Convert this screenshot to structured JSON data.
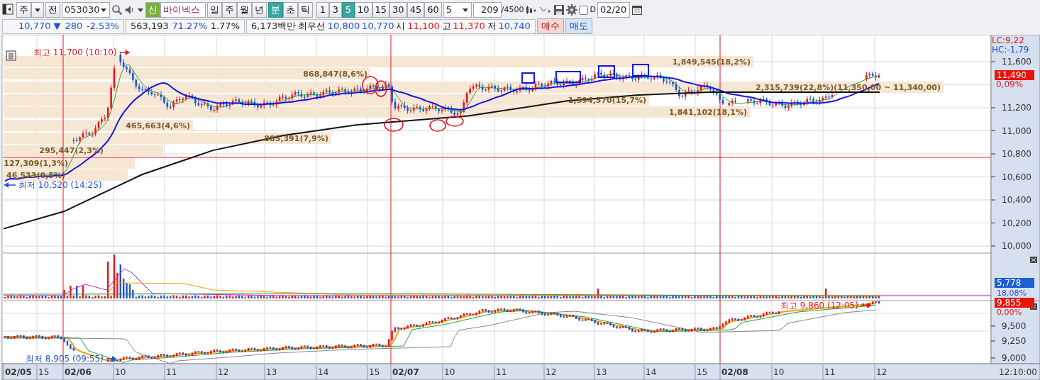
{
  "toolbar": {
    "market": "주",
    "prev_button": "전",
    "code": "053030",
    "badge": "신",
    "name": "바이넥스",
    "periods": [
      {
        "label": "일",
        "selected": false
      },
      {
        "label": "주",
        "selected": false
      },
      {
        "label": "월",
        "selected": false
      },
      {
        "label": "년",
        "selected": false
      }
    ],
    "units": [
      {
        "label": "분",
        "selected": true
      },
      {
        "label": "초",
        "selected": false
      },
      {
        "label": "틱",
        "selected": false
      }
    ],
    "intervals": [
      {
        "label": "1",
        "selected": false
      },
      {
        "label": "3",
        "selected": false
      },
      {
        "label": "5",
        "selected": true
      },
      {
        "label": "10",
        "selected": false
      },
      {
        "label": "15",
        "selected": false
      },
      {
        "label": "30",
        "selected": false
      },
      {
        "label": "45",
        "selected": false
      },
      {
        "label": "60",
        "selected": false
      }
    ],
    "count_select": "5",
    "count": "209",
    "count_total": "/4500",
    "d_checkbox": {
      "label": "D",
      "checked": false
    },
    "date": "02/20"
  },
  "quote": {
    "cells": [
      [
        {
          "text": "10,770 ▼",
          "color": "#1c4fd8"
        },
        {
          "text": "280",
          "color": "#1c4fd8"
        },
        {
          "text": "-2.53%",
          "color": "#1c4fd8"
        }
      ],
      [
        {
          "text": "563,193",
          "color": "#222222"
        },
        {
          "text": "71.27%",
          "color": "#1c4fd8"
        },
        {
          "text": "1.77%",
          "color": "#222222"
        }
      ],
      [
        {
          "text": "6,173백만",
          "color": "#222222"
        },
        {
          "text": "최우선"
        },
        {
          "text": "10,800",
          "color": "#1c4fd8"
        },
        {
          "text": "10,770",
          "color": "#1c4fd8"
        },
        {
          "text": "시"
        },
        {
          "text": "11,100",
          "color": "#e8141c"
        },
        {
          "text": "고"
        },
        {
          "text": "11,370",
          "color": "#e8141c"
        },
        {
          "text": "저"
        },
        {
          "text": "10,740",
          "color": "#1c4fd8"
        }
      ]
    ],
    "buy_button": "매수",
    "sell_button": "매도"
  },
  "price_chart": {
    "annotations": [
      {
        "text": "최고 11,700 (10:10)",
        "kind": "high"
      },
      {
        "text": "최저 10,520 (14:25)",
        "kind": "low"
      }
    ],
    "profile_bands": [
      {
        "label": "1,849,545(18,2%)"
      },
      {
        "label": "868,847(8,6%)"
      },
      {
        "label": "2,315,739(22,8%)(11,350,00 ~ 11,340,00)"
      },
      {
        "label": "1,594,570(15,7%)"
      },
      {
        "label": "1,841,102(18,1%)"
      },
      {
        "label": "465,663(4,6%)"
      },
      {
        "label": "885,391(7,9%)"
      },
      {
        "label": "295,447(2,3%)"
      },
      {
        "label": "127,309(1,3%)"
      },
      {
        "label": "46,533(0,5%)"
      }
    ]
  },
  "price_axis": {
    "lc": "LC:9,22",
    "hc": "HC:-1,79",
    "ticks": [
      "11,600",
      "11,200",
      "11,000",
      "10,800",
      "10,600",
      "10,400",
      "10,200",
      "10,000"
    ],
    "current_price": "11,490",
    "change": "0,09%"
  },
  "volume_axis": {
    "value": "5,778",
    "ratio": "18,08%"
  },
  "lower_chart": {
    "annotations": [
      {
        "text": "최저 8,905 (09:55)",
        "kind": "low"
      },
      {
        "text": "최고 9,860 (12:05)",
        "kind": "high"
      }
    ]
  },
  "lower_axis": {
    "value": "9,855",
    "change": "0,00%",
    "ticks": [
      "9,500",
      "9,250",
      "9,000"
    ]
  },
  "time_axis": {
    "labels": [
      {
        "text": "02/05",
        "kind": "date"
      },
      {
        "text": "15",
        "kind": "hour"
      },
      {
        "text": "02/06",
        "kind": "date"
      },
      {
        "text": "10",
        "kind": "hour"
      },
      {
        "text": "11",
        "kind": "hour"
      },
      {
        "text": "12",
        "kind": "hour"
      },
      {
        "text": "13",
        "kind": "hour"
      },
      {
        "text": "14",
        "kind": "hour"
      },
      {
        "text": "15",
        "kind": "hour"
      },
      {
        "text": "02/07",
        "kind": "date"
      },
      {
        "text": "10",
        "kind": "hour"
      },
      {
        "text": "11",
        "kind": "hour"
      },
      {
        "text": "12",
        "kind": "hour"
      },
      {
        "text": "13",
        "kind": "hour"
      },
      {
        "text": "14",
        "kind": "hour"
      },
      {
        "text": "15",
        "kind": "hour"
      },
      {
        "text": "02/08",
        "kind": "date"
      },
      {
        "text": "10",
        "kind": "hour"
      },
      {
        "text": "11",
        "kind": "hour"
      },
      {
        "text": "12",
        "kind": "hour"
      }
    ],
    "clock": "12:10:00"
  }
}
